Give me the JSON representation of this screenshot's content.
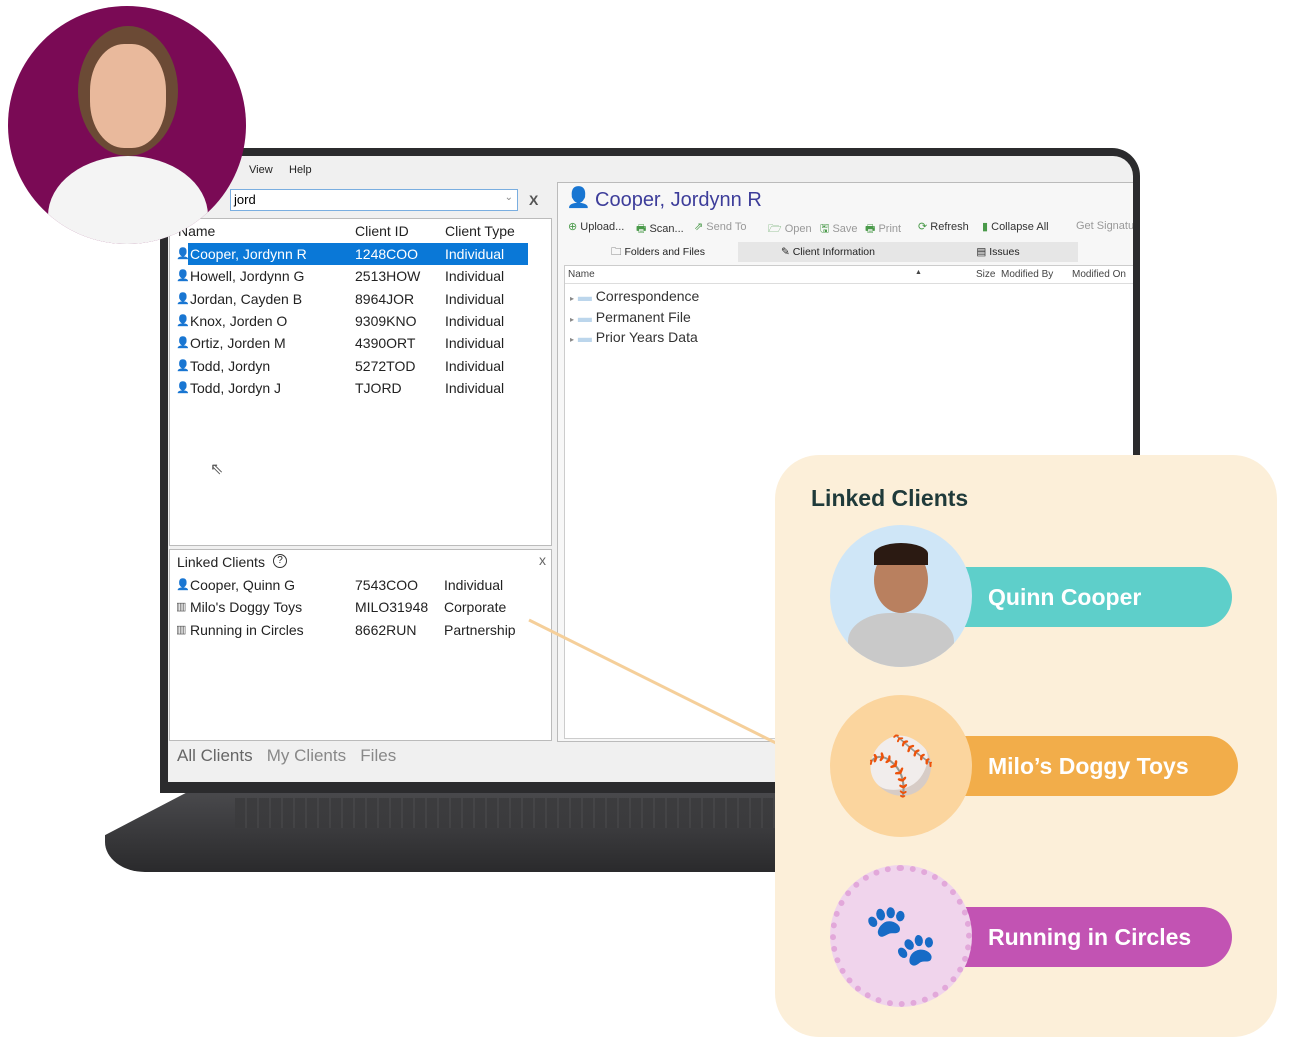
{
  "menu": {
    "view": "View",
    "help": "Help"
  },
  "search": {
    "value": "jord",
    "close": "X"
  },
  "client_list": {
    "headers": [
      "Name",
      "Client ID",
      "Client Type"
    ],
    "rows": [
      {
        "name": "Cooper, Jordynn R",
        "id": "1248COO",
        "type": "Individual",
        "selected": true
      },
      {
        "name": "Howell, Jordynn G",
        "id": "2513HOW",
        "type": "Individual"
      },
      {
        "name": "Jordan, Cayden B",
        "id": "8964JOR",
        "type": "Individual"
      },
      {
        "name": "Knox, Jorden O",
        "id": "9309KNO",
        "type": "Individual"
      },
      {
        "name": "Ortiz, Jorden M",
        "id": "4390ORT",
        "type": "Individual"
      },
      {
        "name": "Todd, Jordyn",
        "id": "5272TOD",
        "type": "Individual"
      },
      {
        "name": "Todd, Jordyn J",
        "id": "TJORD",
        "type": "Individual"
      }
    ]
  },
  "linked_panel": {
    "title": "Linked Clients",
    "close": "x",
    "rows": [
      {
        "name": "Cooper, Quinn G",
        "id": "7543COO",
        "type": "Individual",
        "icon": "person-icon"
      },
      {
        "name": "Milo's Doggy Toys",
        "id": "MILO31948",
        "type": "Corporate",
        "icon": "building-icon"
      },
      {
        "name": "Running in Circles",
        "id": "8662RUN",
        "type": "Partnership",
        "icon": "building-icon"
      }
    ]
  },
  "bottom_tabs": [
    "All Clients",
    "My Clients",
    "Files"
  ],
  "detail": {
    "title": "Cooper, Jordynn R",
    "toolbar": [
      "Upload...",
      "Scan...",
      "Send To",
      "Open",
      "Save",
      "Print",
      "Refresh",
      "Collapse All",
      "Get Signatu"
    ],
    "tabs": [
      "Folders and Files",
      "Client Information",
      "Issues"
    ],
    "columns": [
      "Name",
      "Size",
      "Modified By",
      "Modified On"
    ],
    "folders": [
      "Correspondence",
      "Permanent File",
      "Prior Years Data"
    ]
  },
  "card": {
    "title": "Linked Clients",
    "items": [
      {
        "label": "Quinn Cooper",
        "color": "#5ecfca"
      },
      {
        "label": "Milo’s Doggy Toys",
        "color": "#f2ad4a"
      },
      {
        "label": "Running in Circles",
        "color": "#c253b3"
      }
    ]
  },
  "colors": {
    "avatar_bg": "#7a0a55",
    "selection": "#0a78d7",
    "title": "#3d3d9a",
    "card_bg": "#fcefd9",
    "connector": "#f5cf9a"
  }
}
